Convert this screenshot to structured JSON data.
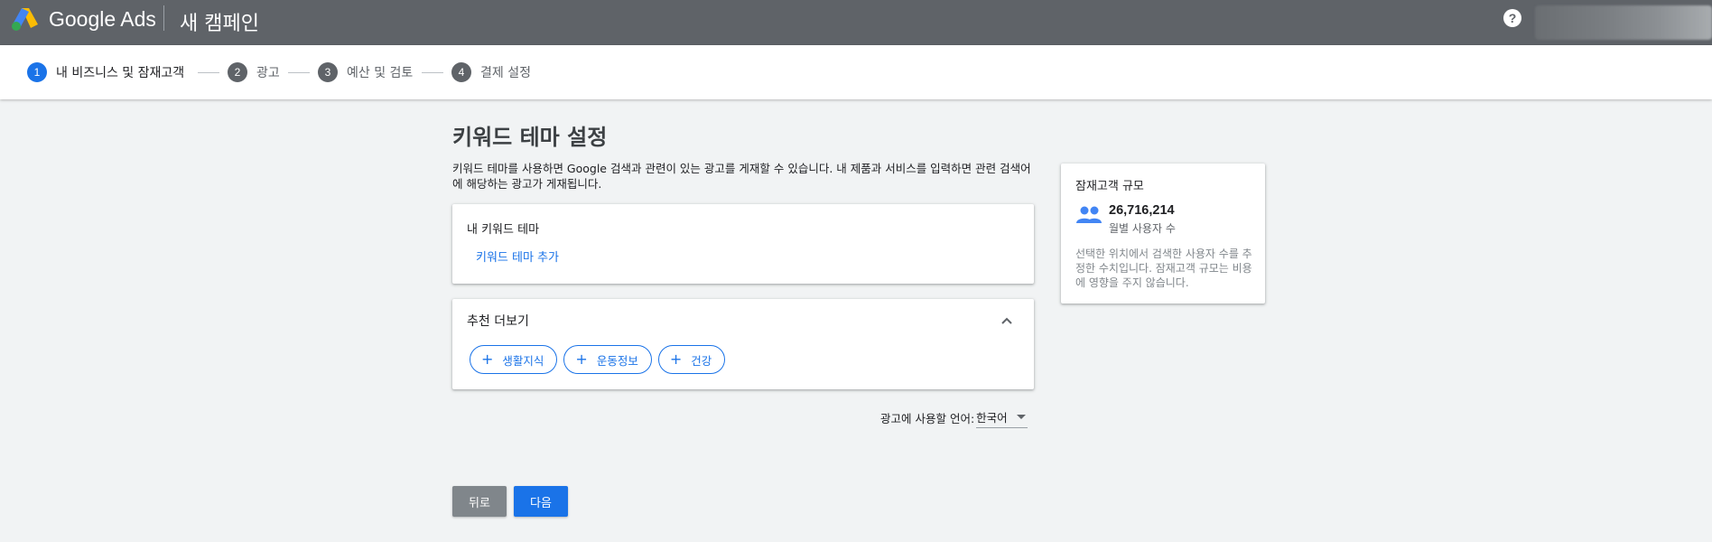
{
  "header": {
    "brand": "Google Ads",
    "campaign_title": "새 캠페인",
    "help_icon": "?"
  },
  "stepper": {
    "steps": [
      {
        "num": "1",
        "label": "내 비즈니스 및 잠재고객"
      },
      {
        "num": "2",
        "label": "광고"
      },
      {
        "num": "3",
        "label": "예산 및 검토"
      },
      {
        "num": "4",
        "label": "결제 설정"
      }
    ]
  },
  "main": {
    "title": "키워드 테마 설정",
    "description": "키워드 테마를 사용하면 Google 검색과 관련이 있는 광고를 게재할 수 있습니다. 내 제품과 서비스를 입력하면 관련 검색어에 해당하는 광고가 게재됩니다.",
    "my_themes": {
      "title": "내 키워드 테마",
      "add_link": "키워드 테마 추가"
    },
    "recommendations": {
      "title": "추천 더보기",
      "chips": [
        "생활지식",
        "운동정보",
        "건강"
      ]
    },
    "language": {
      "label": "광고에 사용할 언어:",
      "value": "한국어"
    },
    "buttons": {
      "back": "뒤로",
      "next": "다음"
    }
  },
  "audience": {
    "title": "잠재고객 규모",
    "count": "26,716,214",
    "count_label": "월별 사용자 수",
    "note": "선택한 위치에서 검색한 사용자 수를 추정한 수치입니다. 잠재고객 규모는 비용에 영향을 주지 않습니다."
  },
  "icons": {
    "logo": "google-ads-logo",
    "help": "help-icon",
    "chevron": "chevron-up-icon",
    "plus": "plus-icon",
    "people": "people-icon",
    "dropdown": "caret-down-icon"
  },
  "colors": {
    "topbar": "#5f6368",
    "accent": "#1a73e8",
    "background": "#f1f3f4"
  }
}
